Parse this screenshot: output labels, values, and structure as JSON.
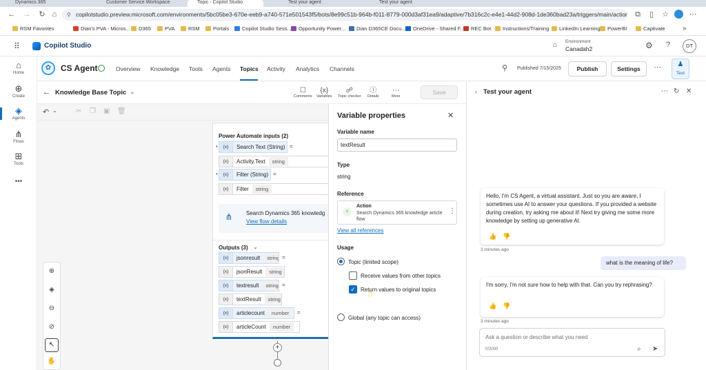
{
  "browser": {
    "tabs": [
      "Dynamics 365",
      "Customer Service Workspace",
      "Topic - Copilot Studio",
      "Test your agent",
      "Test your agent"
    ],
    "url": "copilotstudio.preview.microsoft.com/environments/5bc05be3-670e-eeb9-a740-571e501543f5/bots/8e99c51b-964b-f011-8779-000d3af31ea9/adaptive/7b316c2c-e4e1-44d2-908d-1de360bad23a/triggers/main/actions/T...",
    "bookmarks": [
      "RSM Favorites",
      "Dian's PVA - Micros...",
      "D365",
      "PVA",
      "RSM",
      "Portals",
      "Copilot Studio Sess...",
      "Opportunity Power...",
      "Dian D365CE Docu...",
      "OneDrive - Shared F...",
      "REC Bot",
      "Instructions/Training",
      "LinkedIn Learning",
      "PowerBI",
      "Captivate"
    ],
    "more_bookmarks": "»"
  },
  "app": {
    "name": "Copilot Studio",
    "env_label": "Environment",
    "env_name": "Canadah2",
    "avatar": "DT"
  },
  "rail": [
    {
      "label": "Home",
      "icon": "home-icon",
      "glyph": "⌂"
    },
    {
      "label": "Create",
      "icon": "plus-circle-icon",
      "glyph": "⊕"
    },
    {
      "label": "Agents",
      "icon": "agents-icon",
      "glyph": "◈"
    },
    {
      "label": "Flows",
      "icon": "flows-icon",
      "glyph": "⋔"
    },
    {
      "label": "Tools",
      "icon": "tools-icon",
      "glyph": "⊞"
    },
    {
      "label": "",
      "icon": "more-icon",
      "glyph": "•••"
    }
  ],
  "agent": {
    "name": "CS Agent",
    "tabs": [
      "Overview",
      "Knowledge",
      "Tools",
      "Agents",
      "Topics",
      "Activity",
      "Analytics",
      "Channels"
    ],
    "selected_tab": "Topics",
    "published": "Published 7/15/2025",
    "publish_label": "Publish",
    "settings_label": "Settings",
    "test_label": "Test"
  },
  "topic": {
    "title": "Knowledge Base Topic",
    "tools": [
      "Comments",
      "Variables",
      "Topic checker",
      "Details",
      "More"
    ],
    "save_label": "Save"
  },
  "node": {
    "inputs_title": "Power Automate inputs (2)",
    "inputs": [
      {
        "name": "Search Text (String)",
        "kind": "param"
      },
      {
        "name": "Activity.Text",
        "type": "string",
        "kind": "value"
      },
      {
        "name": "Filter (String)",
        "kind": "param"
      },
      {
        "name": "Filter",
        "type": "string",
        "kind": "value"
      }
    ],
    "flow_name": "Search Dynamics 365 knowledg",
    "flow_link": "View flow details",
    "outputs_title": "Outputs (3)",
    "outputs": [
      {
        "name": "jsonresult",
        "type": "string",
        "kind": "param"
      },
      {
        "name": "jsonResult",
        "type": "string",
        "kind": "value"
      },
      {
        "name": "textresult",
        "type": "string",
        "kind": "param"
      },
      {
        "name": "textResult",
        "type": "string",
        "kind": "value"
      },
      {
        "name": "articlecount",
        "type": "number",
        "kind": "param"
      },
      {
        "name": "articleCount",
        "type": "number",
        "kind": "value"
      }
    ],
    "var_badge": "{x}"
  },
  "var_panel": {
    "title": "Variable properties",
    "name_label": "Variable name",
    "name_value": "textResult",
    "type_label": "Type",
    "type_value": "string",
    "reference_label": "Reference",
    "ref_kind": "Action",
    "ref_desc": "Search Dynamics 365 knowledge article flow",
    "view_all": "View all references",
    "usage_label": "Usage",
    "usage_topic": "Topic (limited scope)",
    "receive": "Receive values from other topics",
    "return": "Return values to original topics",
    "global": "Global (any topic can access)"
  },
  "chat": {
    "title": "Test your agent",
    "bot_greeting": "Hello, I'm CS Agent, a virtual assistant. Just so you are aware, I sometimes use AI to answer your questions. If you provided a website during creation, try asking me about it! Next try giving me some more knowledge by setting up generative AI.",
    "time1": "3 minutes ago",
    "user_msg": "what is the meaning of life?",
    "bot_reply": "I'm sorry, I'm not sure how to help with that. Can you try rephrasing?",
    "time2": "3 minutes ago",
    "input_placeholder": "Ask a question or describe what you need",
    "char_count": "0/2000"
  },
  "colors": {
    "accent": "#0f6cbd",
    "flow_blue": "#1f6ea9",
    "user_bubble": "#e8ebfa"
  }
}
